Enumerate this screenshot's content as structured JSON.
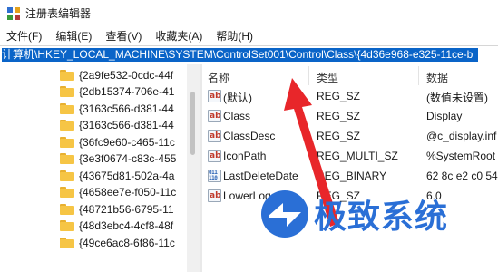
{
  "window": {
    "title": "注册表编辑器"
  },
  "menu": [
    {
      "label": "文件(F)"
    },
    {
      "label": "编辑(E)"
    },
    {
      "label": "查看(V)"
    },
    {
      "label": "收藏夹(A)"
    },
    {
      "label": "帮助(H)"
    }
  ],
  "address": {
    "path": "计算机\\HKEY_LOCAL_MACHINE\\SYSTEM\\ControlSet001\\Control\\Class\\{4d36e968-e325-11ce-b"
  },
  "tree": {
    "items": [
      {
        "label": "{2a9fe532-0cdc-44f"
      },
      {
        "label": "{2db15374-706e-41"
      },
      {
        "label": "{3163c566-d381-44"
      },
      {
        "label": "{3163c566-d381-44"
      },
      {
        "label": "{36fc9e60-c465-11c"
      },
      {
        "label": "{3e3f0674-c83c-455"
      },
      {
        "label": "{43675d81-502a-4a"
      },
      {
        "label": "{4658ee7e-f050-11c"
      },
      {
        "label": "{48721b56-6795-11"
      },
      {
        "label": "{48d3ebc4-4cf8-48f"
      },
      {
        "label": "{49ce6ac8-6f86-11c"
      }
    ]
  },
  "list": {
    "headers": {
      "name": "名称",
      "type": "类型",
      "data": "数据"
    },
    "rows": [
      {
        "icon": "string-value-icon",
        "name": "(默认)",
        "type": "REG_SZ",
        "data": "(数值未设置)"
      },
      {
        "icon": "string-value-icon",
        "name": "Class",
        "type": "REG_SZ",
        "data": "Display"
      },
      {
        "icon": "string-value-icon",
        "name": "ClassDesc",
        "type": "REG_SZ",
        "data": "@c_display.inf"
      },
      {
        "icon": "string-value-icon",
        "name": "IconPath",
        "type": "REG_MULTI_SZ",
        "data": "%SystemRoot"
      },
      {
        "icon": "binary-value-icon",
        "name": "LastDeleteDate",
        "type": "REG_BINARY",
        "data": "62 8c e2 c0 54"
      },
      {
        "icon": "string-value-icon",
        "name": "LowerLogoVer...",
        "type": "REG_SZ",
        "data": "6.0"
      }
    ]
  },
  "watermark": {
    "text": "极致系统"
  },
  "colors": {
    "address_highlight": "#0a64c8",
    "arrow": "#e8262a",
    "watermark": "#2a6fd6",
    "folder": "#f6c545"
  }
}
